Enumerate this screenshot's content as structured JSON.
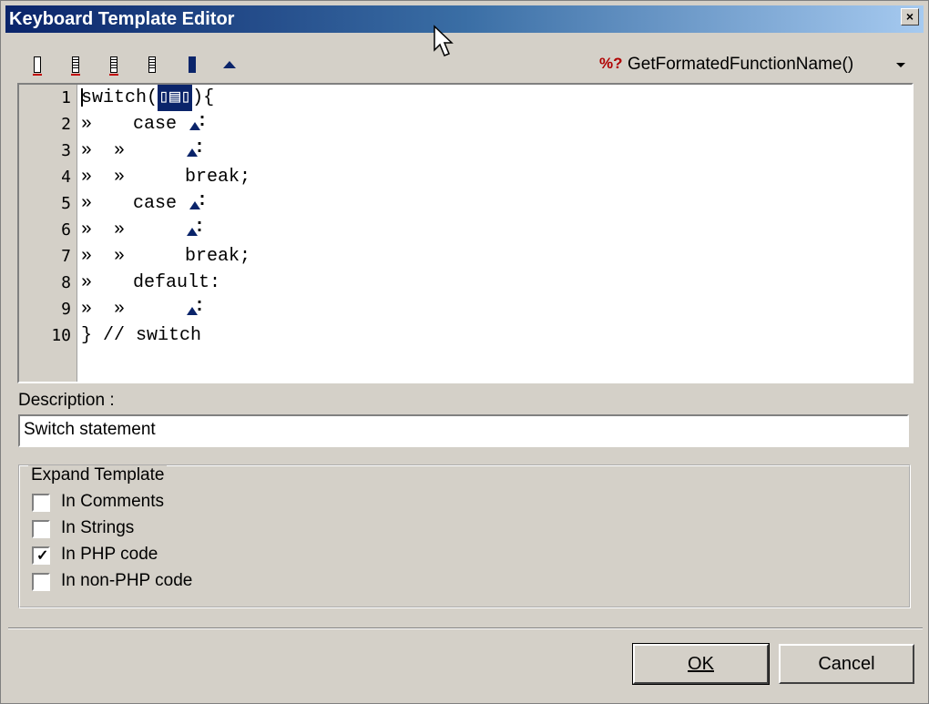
{
  "window": {
    "title": "Keyboard Template Editor",
    "close_glyph": "×"
  },
  "toolbar": {
    "buttons": [
      {
        "name": "insert-field-icon"
      },
      {
        "name": "clipboard-icon"
      },
      {
        "name": "clipboard-icon"
      },
      {
        "name": "clipboard-icon"
      },
      {
        "name": "insert-selection-icon"
      },
      {
        "name": "cursor-position-icon"
      }
    ],
    "function_select": {
      "icon": "%?",
      "value": "GetFormatedFunctionName()"
    }
  },
  "editor": {
    "line_numbers": [
      "1",
      "2",
      "3",
      "4",
      "5",
      "6",
      "7",
      "8",
      "9",
      "10"
    ],
    "lines": [
      {
        "text": "switch(",
        "tail": "){"
      },
      {
        "tabs": "»",
        "text": "case ",
        "mark": ":"
      },
      {
        "tabs": "»  »",
        "text": "",
        "mark": ":"
      },
      {
        "tabs": "»  »",
        "text": "break;"
      },
      {
        "tabs": "»",
        "text": "case ",
        "mark": ":"
      },
      {
        "tabs": "»  »",
        "text": "",
        "mark": ":"
      },
      {
        "tabs": "»  »",
        "text": "break;"
      },
      {
        "tabs": "»",
        "text": "default:"
      },
      {
        "tabs": "»  »",
        "text": "",
        "mark": ":"
      },
      {
        "text": "} // switch"
      }
    ]
  },
  "description": {
    "label": "Description :",
    "value": "Switch statement"
  },
  "expand": {
    "legend": "Expand Template",
    "options": [
      {
        "label": "In Comments",
        "checked": false
      },
      {
        "label": "In Strings",
        "checked": false
      },
      {
        "label": "In PHP code",
        "checked": true
      },
      {
        "label": "In non-PHP code",
        "checked": false
      }
    ]
  },
  "buttons": {
    "ok": "OK",
    "cancel": "Cancel"
  }
}
